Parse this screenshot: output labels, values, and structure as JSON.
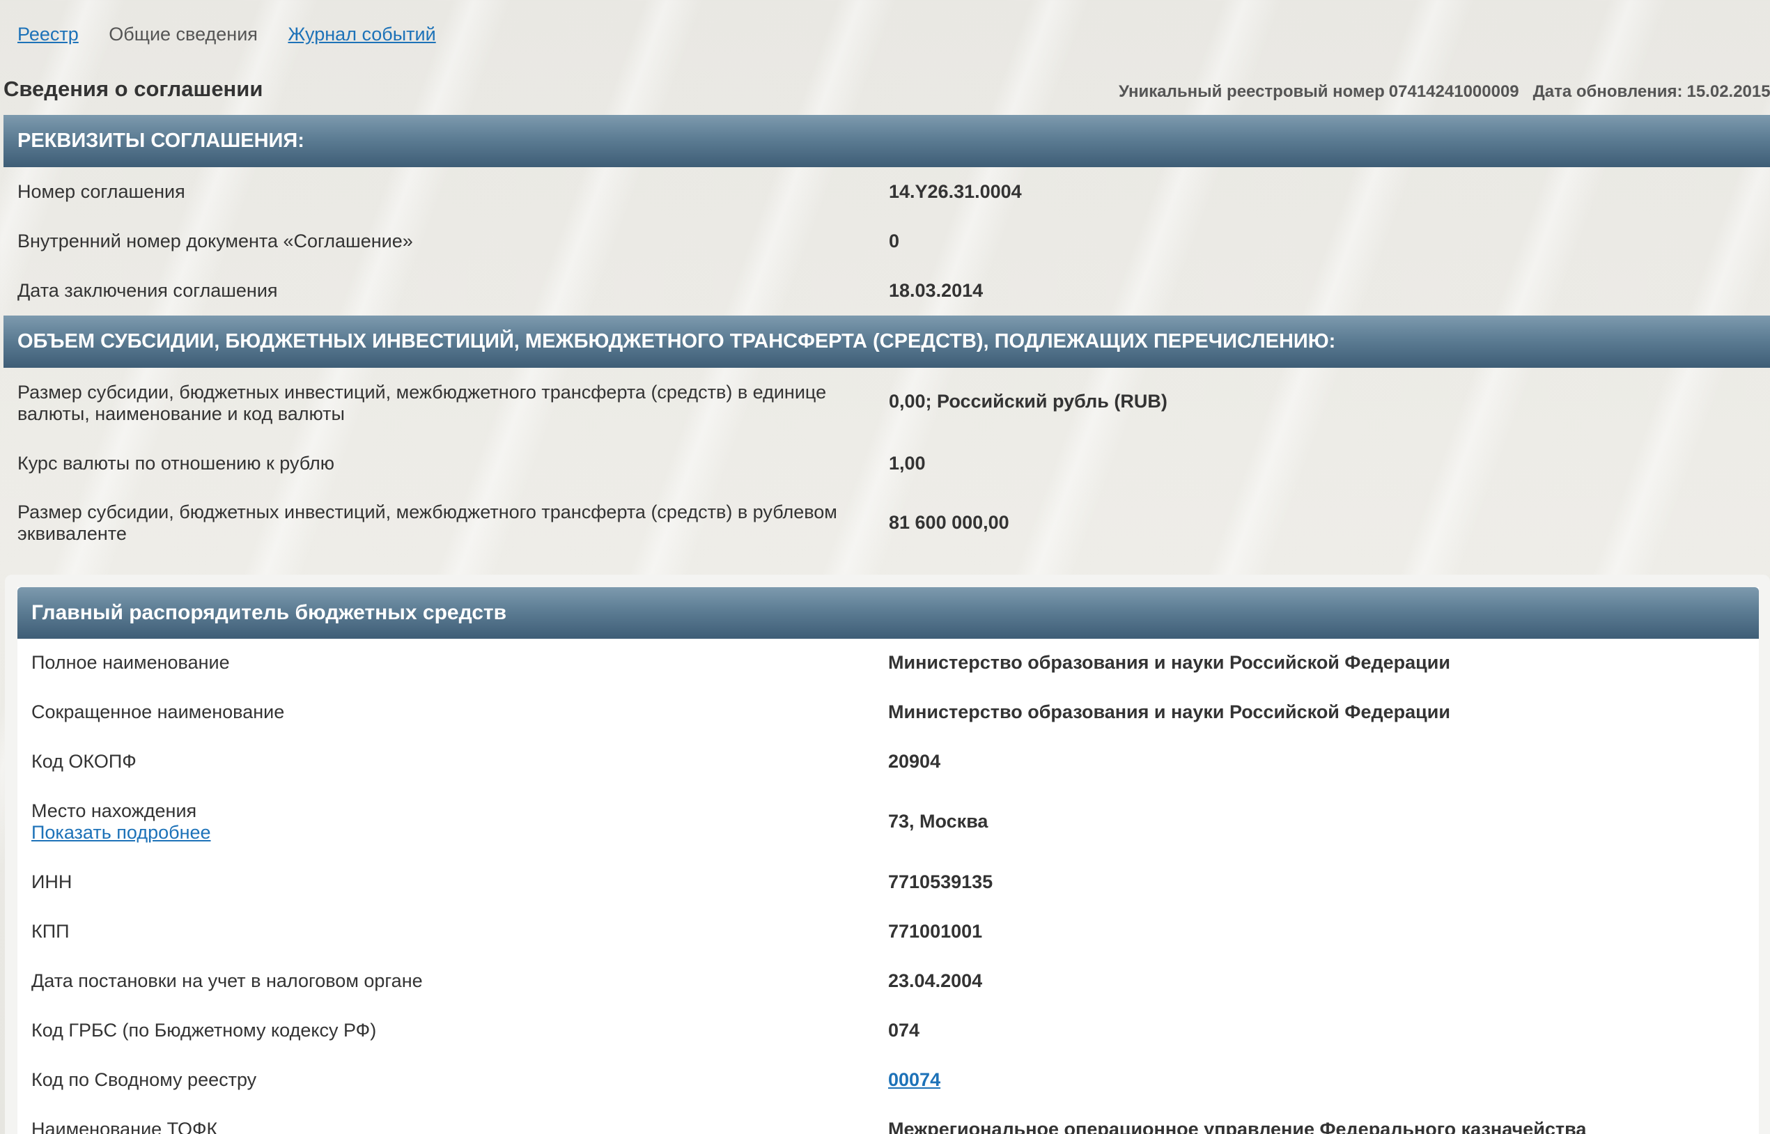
{
  "nav": {
    "tabs": [
      {
        "label": "Реестр",
        "link": true
      },
      {
        "label": "Общие сведения",
        "link": false
      },
      {
        "label": "Журнал событий",
        "link": true
      }
    ]
  },
  "header": {
    "title": "Сведения о соглашении",
    "registry_label": "Уникальный реестровый номер",
    "registry_number": "07414241000009",
    "update_label": "Дата обновления:",
    "update_date": "15.02.2015"
  },
  "sections": {
    "requisites": {
      "title": "РЕКВИЗИТЫ СОГЛАШЕНИЯ:",
      "rows": [
        {
          "label": "Номер соглашения",
          "value": "14.Y26.31.0004"
        },
        {
          "label": "Внутренний номер документа «Соглашение»",
          "value": "0"
        },
        {
          "label": "Дата заключения соглашения",
          "value": "18.03.2014"
        }
      ]
    },
    "volume": {
      "title": "ОБЪЕМ СУБСИДИИ, БЮДЖЕТНЫХ ИНВЕСТИЦИЙ, МЕЖБЮДЖЕТНОГО ТРАНСФЕРТА (СРЕДСТВ), ПОДЛЕЖАЩИХ ПЕРЕЧИСЛЕНИЮ:",
      "rows": [
        {
          "label": "Размер субсидии, бюджетных инвестиций, межбюджетного трансферта (средств) в единице валюты, наименование и код валюты",
          "value": "0,00; Российский рубль (RUB)"
        },
        {
          "label": "Курс валюты по отношению к рублю",
          "value": "1,00"
        },
        {
          "label": "Размер субсидии, бюджетных инвестиций, межбюджетного трансферта (средств) в рублевом эквиваленте",
          "value": "81 600 000,00"
        }
      ]
    },
    "grbs": {
      "title": "Главный распорядитель бюджетных средств",
      "rows": [
        {
          "label": "Полное наименование",
          "value": "Министерство образования и науки Российской Федерации"
        },
        {
          "label": "Сокращенное наименование",
          "value": "Министерство образования и науки Российской Федерации"
        },
        {
          "label": "Код ОКОПФ",
          "value": "20904"
        },
        {
          "label": "Место нахождения",
          "sublink": "Показать подробнее",
          "value": "73, Москва"
        },
        {
          "label": "ИНН",
          "value": "7710539135"
        },
        {
          "label": "КПП",
          "value": "771001001"
        },
        {
          "label": "Дата постановки на учет в налоговом органе",
          "value": "23.04.2004"
        },
        {
          "label": "Код ГРБС (по Бюджетному кодексу РФ)",
          "value": "074"
        },
        {
          "label": "Код по Сводному реестру",
          "value": "00074"
        },
        {
          "label": "Наименование ТОФК",
          "value": "Межрегиональное операционное управление Федерального казначейства"
        }
      ]
    }
  }
}
